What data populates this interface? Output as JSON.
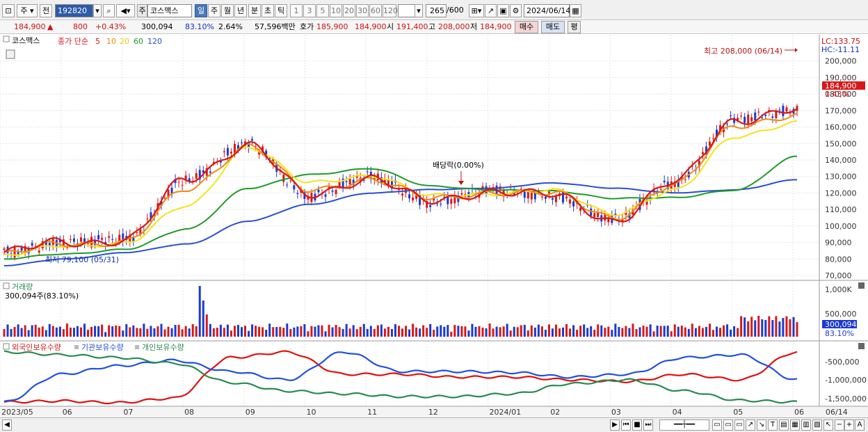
{
  "toolbar": {
    "type_label": "주",
    "prev_label": "전",
    "code": "192820",
    "market_badge": "주",
    "stock_name": "코스맥스",
    "periods": [
      "일",
      "주",
      "월",
      "년",
      "분",
      "초",
      "틱"
    ],
    "active_period": "일",
    "intervals": [
      "1",
      "3",
      "5",
      "10",
      "20",
      "30",
      "60",
      "120"
    ],
    "count": "265",
    "count_total": "/600",
    "date": "2024/06/14"
  },
  "quote": {
    "price": "184,900",
    "change": "800",
    "change_pct": "+0.43%",
    "volume": "300,094",
    "vol_ratio": "83.10%",
    "turnover": "2.64%",
    "amount": "57,596백만",
    "hoga_label": "호가",
    "ask": "185,900",
    "bid": "184,900",
    "open_label": "시",
    "open": "191,400",
    "high_label": "고",
    "high": "208,000",
    "low_label": "저",
    "low": "184,900",
    "buy_label": "매수",
    "sell_label": "매도",
    "eval_label": "평"
  },
  "price_panel": {
    "name_tag": "코스맥스",
    "ma_label": "종가 단순",
    "ma_periods": [
      "5",
      "10",
      "20",
      "60",
      "120"
    ],
    "lc": "LC:133.75",
    "hc": "HC:-11.11",
    "high_annotation": "최고 208,000 (06/14)",
    "low_annotation": "최저 79,100 (05/31)",
    "dividend_annotation": "배당락(0.00%)",
    "current_price": "184,900",
    "current_change": "0.43%",
    "y_ticks": [
      "200,000",
      "190,000",
      "180,000",
      "170,000",
      "160,000",
      "150,000",
      "140,000",
      "130,000",
      "120,000",
      "110,000",
      "100,000",
      "90,000",
      "80,000",
      "70,000"
    ]
  },
  "volume_panel": {
    "title": "거래량",
    "value": "300,094주(83.10%)",
    "y_ticks": [
      "1,000K",
      "500,000"
    ],
    "current": "300,094",
    "current_pct": "83.10%"
  },
  "holding_panel": {
    "legend": [
      "외국인보유수량",
      "기관보유수량",
      "개인보유수량"
    ],
    "y_ticks": [
      "-500,000",
      "-1,000,000",
      "-1,500,000"
    ]
  },
  "x_axis": {
    "labels": [
      "2023/05",
      "06",
      "07",
      "08",
      "09",
      "10",
      "11",
      "12",
      "2024/01",
      "02",
      "03",
      "04",
      "05",
      "06"
    ],
    "last": "06/14"
  },
  "colors": {
    "ma5": "#d81818",
    "ma10": "#f08a10",
    "ma20": "#f4e416",
    "ma60": "#1e9a2a",
    "ma120": "#2a4fd0",
    "up": "#d81818",
    "down": "#1a3ad0",
    "foreign": "#e01010",
    "institution": "#2050e0",
    "individual": "#2a8a50"
  },
  "chart_data": {
    "type": "line",
    "x": [
      "2023/05",
      "06",
      "07",
      "08",
      "09",
      "10",
      "11",
      "12",
      "2024/01",
      "02",
      "03",
      "04",
      "05",
      "06"
    ],
    "series": [
      {
        "name": "5",
        "values": [
          84000,
          90000,
          92000,
          128000,
          150000,
          118000,
          130000,
          114000,
          122000,
          118000,
          104000,
          126000,
          165000,
          170000
        ]
      },
      {
        "name": "10",
        "values": [
          83000,
          89000,
          91000,
          122000,
          149000,
          121000,
          129000,
          116000,
          121000,
          119000,
          106000,
          124000,
          162000,
          166000
        ]
      },
      {
        "name": "20",
        "values": [
          82000,
          88000,
          90000,
          112000,
          148000,
          126000,
          131000,
          118000,
          120000,
          121000,
          108000,
          121000,
          155000,
          162000
        ]
      },
      {
        "name": "60",
        "values": [
          80000,
          83000,
          86000,
          98000,
          123000,
          131000,
          135000,
          124000,
          122000,
          121000,
          117000,
          117000,
          122000,
          142000
        ]
      },
      {
        "name": "120",
        "values": [
          76000,
          80000,
          84000,
          89000,
          103000,
          113000,
          120000,
          122000,
          123000,
          126000,
          123000,
          120000,
          122000,
          128000
        ]
      }
    ],
    "high": 208000,
    "low": 79100,
    "ylim": [
      70000,
      210000
    ]
  }
}
